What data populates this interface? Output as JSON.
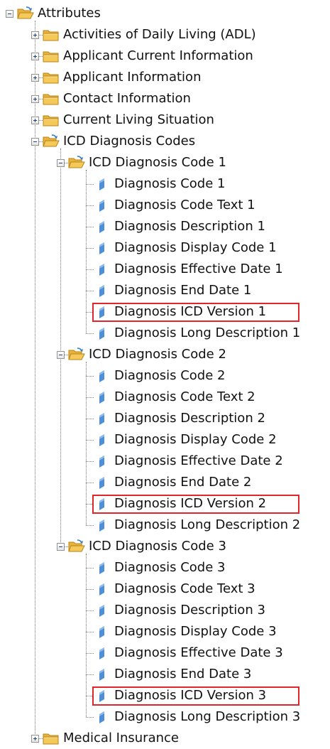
{
  "tree": {
    "rows": [
      {
        "label": "Attributes",
        "indent": 0,
        "type": "folder-open",
        "toggle": "minus",
        "highlight": false
      },
      {
        "label": "Activities of Daily Living (ADL)",
        "indent": 1,
        "type": "folder-closed",
        "toggle": "plus",
        "highlight": false
      },
      {
        "label": "Applicant Current Information",
        "indent": 1,
        "type": "folder-closed",
        "toggle": "plus",
        "highlight": false
      },
      {
        "label": "Applicant Information",
        "indent": 1,
        "type": "folder-closed",
        "toggle": "plus",
        "highlight": false
      },
      {
        "label": "Contact Information",
        "indent": 1,
        "type": "folder-closed",
        "toggle": "plus",
        "highlight": false
      },
      {
        "label": "Current Living Situation",
        "indent": 1,
        "type": "folder-closed",
        "toggle": "plus",
        "highlight": false
      },
      {
        "label": "ICD Diagnosis Codes",
        "indent": 1,
        "type": "folder-open",
        "toggle": "minus",
        "highlight": false
      },
      {
        "label": "ICD Diagnosis Code 1",
        "indent": 2,
        "type": "folder-open",
        "toggle": "minus",
        "highlight": false
      },
      {
        "label": "Diagnosis Code 1",
        "indent": 3,
        "type": "attribute",
        "toggle": "none",
        "highlight": false
      },
      {
        "label": "Diagnosis Code Text 1",
        "indent": 3,
        "type": "attribute",
        "toggle": "none",
        "highlight": false
      },
      {
        "label": "Diagnosis Description 1",
        "indent": 3,
        "type": "attribute",
        "toggle": "none",
        "highlight": false
      },
      {
        "label": "Diagnosis Display Code 1",
        "indent": 3,
        "type": "attribute",
        "toggle": "none",
        "highlight": false
      },
      {
        "label": "Diagnosis Effective Date 1",
        "indent": 3,
        "type": "attribute",
        "toggle": "none",
        "highlight": false
      },
      {
        "label": "Diagnosis End Date 1",
        "indent": 3,
        "type": "attribute",
        "toggle": "none",
        "highlight": false
      },
      {
        "label": "Diagnosis ICD Version 1",
        "indent": 3,
        "type": "attribute",
        "toggle": "none",
        "highlight": true
      },
      {
        "label": "Diagnosis Long Description 1",
        "indent": 3,
        "type": "attribute",
        "toggle": "none",
        "highlight": false
      },
      {
        "label": "ICD Diagnosis Code 2",
        "indent": 2,
        "type": "folder-open",
        "toggle": "minus",
        "highlight": false
      },
      {
        "label": "Diagnosis Code 2",
        "indent": 3,
        "type": "attribute",
        "toggle": "none",
        "highlight": false
      },
      {
        "label": "Diagnosis Code Text 2",
        "indent": 3,
        "type": "attribute",
        "toggle": "none",
        "highlight": false
      },
      {
        "label": "Diagnosis Description 2",
        "indent": 3,
        "type": "attribute",
        "toggle": "none",
        "highlight": false
      },
      {
        "label": "Diagnosis Display Code 2",
        "indent": 3,
        "type": "attribute",
        "toggle": "none",
        "highlight": false
      },
      {
        "label": "Diagnosis Effective Date 2",
        "indent": 3,
        "type": "attribute",
        "toggle": "none",
        "highlight": false
      },
      {
        "label": "Diagnosis End Date 2",
        "indent": 3,
        "type": "attribute",
        "toggle": "none",
        "highlight": false
      },
      {
        "label": "Diagnosis ICD Version 2",
        "indent": 3,
        "type": "attribute",
        "toggle": "none",
        "highlight": true
      },
      {
        "label": "Diagnosis Long Description 2",
        "indent": 3,
        "type": "attribute",
        "toggle": "none",
        "highlight": false
      },
      {
        "label": "ICD Diagnosis Code 3",
        "indent": 2,
        "type": "folder-open",
        "toggle": "minus",
        "highlight": false
      },
      {
        "label": "Diagnosis Code 3",
        "indent": 3,
        "type": "attribute",
        "toggle": "none",
        "highlight": false
      },
      {
        "label": "Diagnosis Code Text 3",
        "indent": 3,
        "type": "attribute",
        "toggle": "none",
        "highlight": false
      },
      {
        "label": "Diagnosis Description 3",
        "indent": 3,
        "type": "attribute",
        "toggle": "none",
        "highlight": false
      },
      {
        "label": "Diagnosis Display Code 3",
        "indent": 3,
        "type": "attribute",
        "toggle": "none",
        "highlight": false
      },
      {
        "label": "Diagnosis Effective Date 3",
        "indent": 3,
        "type": "attribute",
        "toggle": "none",
        "highlight": false
      },
      {
        "label": "Diagnosis End Date 3",
        "indent": 3,
        "type": "attribute",
        "toggle": "none",
        "highlight": false
      },
      {
        "label": "Diagnosis ICD Version 3",
        "indent": 3,
        "type": "attribute",
        "toggle": "none",
        "highlight": true
      },
      {
        "label": "Diagnosis Long Description 3",
        "indent": 3,
        "type": "attribute",
        "toggle": "none",
        "highlight": false
      },
      {
        "label": "Medical Insurance",
        "indent": 1,
        "type": "folder-closed",
        "toggle": "plus",
        "highlight": false
      }
    ]
  },
  "colors": {
    "highlight": "#e0262b",
    "folder": "#f4c95a",
    "attribute": "#4f8fd8"
  }
}
